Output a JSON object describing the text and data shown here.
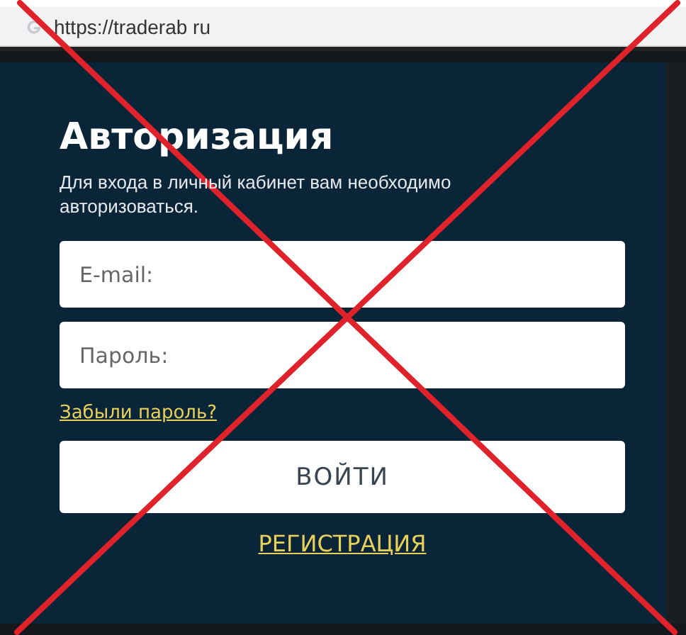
{
  "browser": {
    "url": "https://traderab ru"
  },
  "login": {
    "title": "Авторизация",
    "subtitle": "Для входа в личный кабинет вам необходимо авторизоваться.",
    "fields": [
      {
        "placeholder": "E-mail:"
      },
      {
        "placeholder": "Пароль:"
      }
    ],
    "forgot_link": "Забыли пароль?",
    "submit": "ВОЙТИ",
    "register_link": "РЕГИСТРАЦИЯ"
  },
  "overlay": {
    "kind": "cross"
  }
}
